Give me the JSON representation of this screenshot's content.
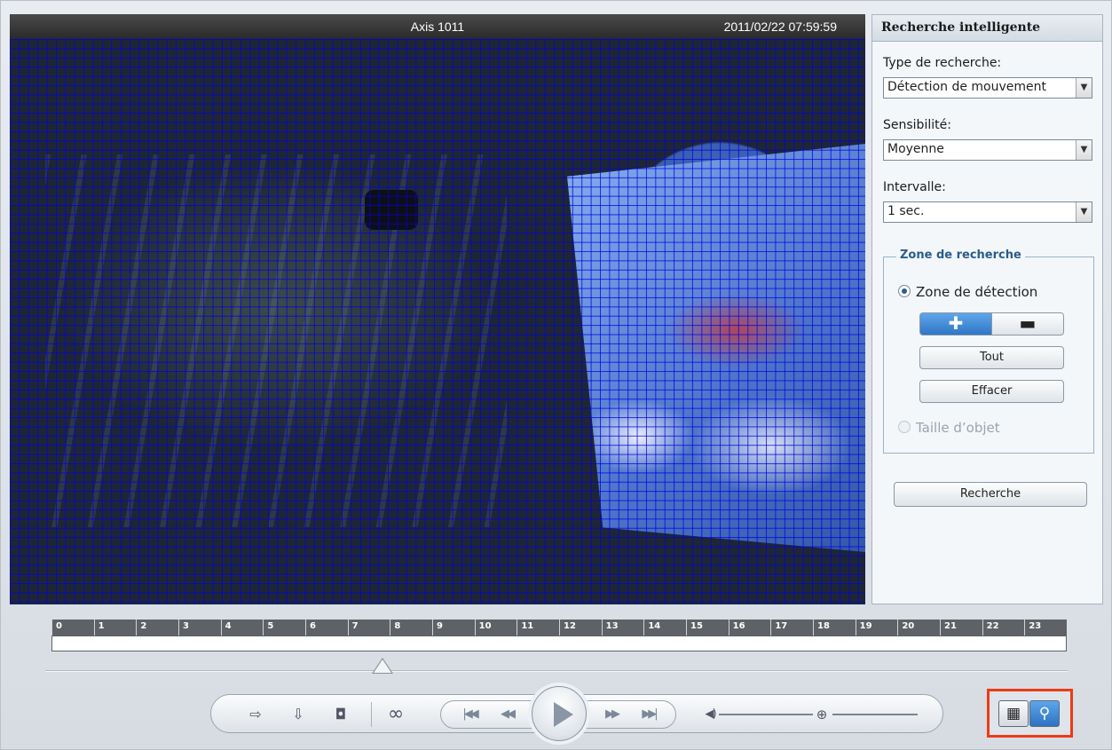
{
  "video": {
    "camera_name": "Axis 1011",
    "timestamp": "2011/02/22 07:59:59"
  },
  "panel": {
    "title": "Recherche intelligente",
    "search_type_label": "Type de recherche:",
    "search_type_value": "Détection de mouvement",
    "sensitivity_label": "Sensibilité:",
    "sensitivity_value": "Moyenne",
    "interval_label": "Intervalle:",
    "interval_value": "1 sec.",
    "zone": {
      "legend": "Zone de recherche",
      "detection_zone_label": "Zone de détection",
      "add_label": "✚",
      "remove_label": "▬",
      "all_label": "Tout",
      "clear_label": "Effacer",
      "object_size_label": "Taille d’objet"
    },
    "search_button": "Recherche"
  },
  "timeline": {
    "hours": [
      "0",
      "1",
      "2",
      "3",
      "4",
      "5",
      "6",
      "7",
      "8",
      "9",
      "10",
      "11",
      "12",
      "13",
      "14",
      "15",
      "16",
      "17",
      "18",
      "19",
      "20",
      "21",
      "22",
      "23"
    ],
    "position": 0.33
  },
  "controls": {
    "export_icon": "⇨",
    "download_icon": "⇩",
    "snapshot_icon": "◘",
    "link_icon": "∞",
    "first_icon": "|◀◀",
    "rewind_icon": "◀◀",
    "forward_icon": "▶▶",
    "last_icon": "▶▶|",
    "volume_icon": "◀)",
    "zoom_icon": "⊕"
  },
  "view_buttons": {
    "film_icon": "▦",
    "search_icon": "⚲"
  },
  "colors": {
    "accent": "#2f76c6",
    "highlight": "#ee3b14",
    "grid": "#0000e6"
  }
}
